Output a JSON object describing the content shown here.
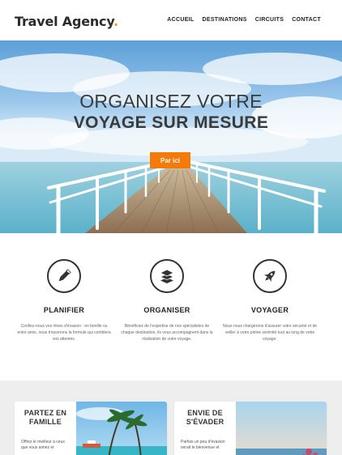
{
  "header": {
    "logo_text": "Travel Agency",
    "logo_dot": ".",
    "nav": [
      "ACCUEIL",
      "DESTINATIONS",
      "CIRCUITS",
      "CONTACT"
    ]
  },
  "hero": {
    "title_line1": "ORGANISEZ VOTRE",
    "title_line2": "VOYAGE SUR MESURE",
    "cta_label": "Par ici"
  },
  "features": [
    {
      "icon": "pencil-icon",
      "title": "PLANIFIER",
      "text": "Confiez-nous vos rêves d'évasion : en famille ou entre amis, nous trouverons la formule qui comblera vos attentes."
    },
    {
      "icon": "layers-icon",
      "title": "ORGANISER",
      "text": "Bénéficiez de l'expertise de nos spécialistes de chaque destination, ils vous accompagnent dans la réalisation de votre voyage."
    },
    {
      "icon": "rocket-icon",
      "title": "VOYAGER",
      "text": "Nous nous chargerons d'assurer votre sécurité et de veiller à votre pleine sérénité tout au long de votre voyage."
    }
  ],
  "cards": [
    {
      "title": "PARTEZ EN FAMILLE",
      "text": "Offrez le meilleur à ceux que vous aimez et"
    },
    {
      "title": "ENVIE DE S'ÉVADER",
      "text": "Parfois un peu d'évasion serait le bienvenue et"
    }
  ],
  "colors": {
    "accent": "#f47a0a",
    "logo_dot": "#f39c12",
    "section_bg": "#eeeeee"
  }
}
